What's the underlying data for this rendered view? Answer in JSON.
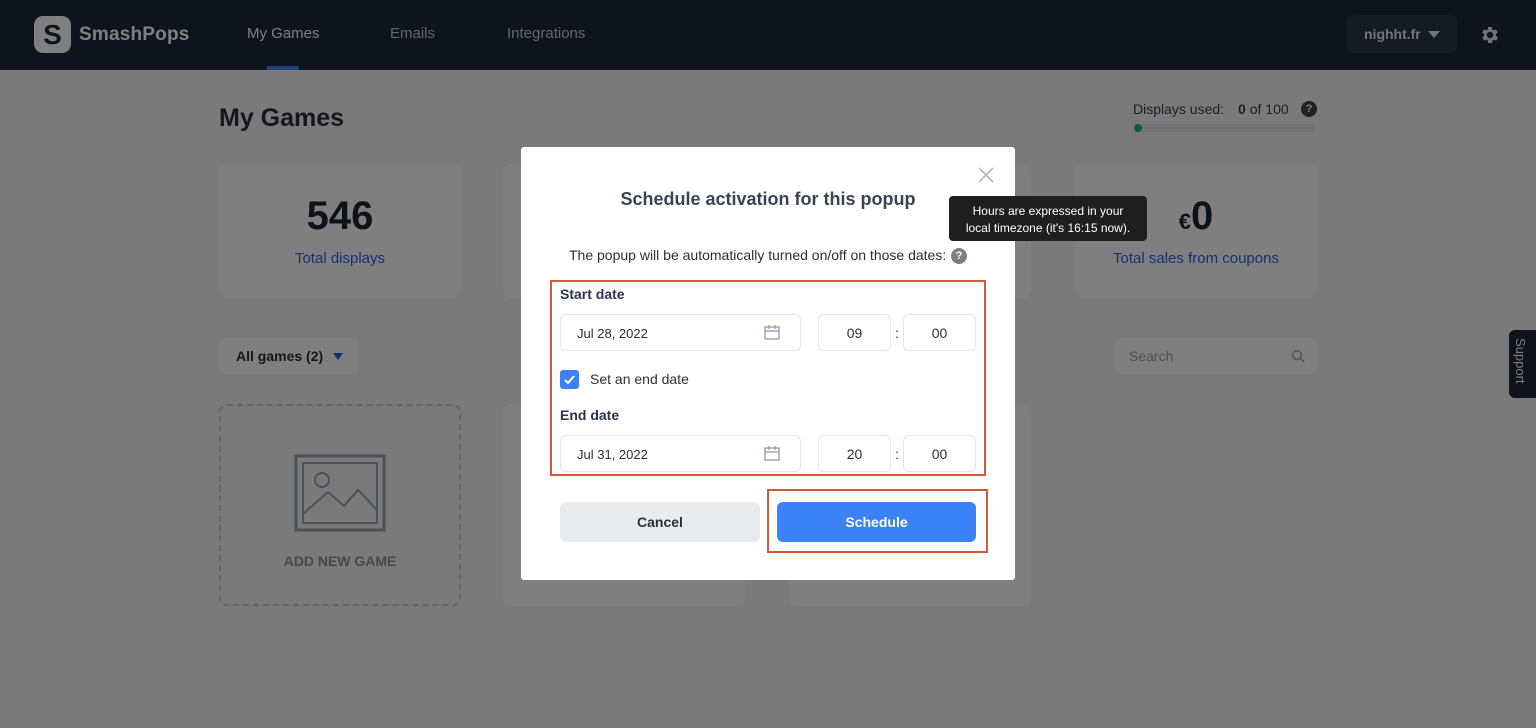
{
  "brand": {
    "logo_letter": "S",
    "name": "SmashPops"
  },
  "nav": {
    "items": [
      "My Games",
      "Emails",
      "Integrations"
    ],
    "active": "My Games"
  },
  "account": {
    "label": "nighht.fr"
  },
  "page": {
    "title": "My Games"
  },
  "usage": {
    "label": "Displays used:",
    "used": "0",
    "of": "of 100",
    "fraction": 0.0
  },
  "stats": [
    {
      "value": "546",
      "label": "Total displays"
    },
    {
      "value": "0",
      "currency": "€",
      "label": "Total sales from coupons"
    }
  ],
  "filter": {
    "label": "All games (2)"
  },
  "search": {
    "placeholder": "Search"
  },
  "add_game": {
    "label": "ADD NEW GAME"
  },
  "support": {
    "label": "Support"
  },
  "modal": {
    "title": "Schedule activation for this popup",
    "description": "The popup will be automatically turned on/off on those dates:",
    "start_label": "Start date",
    "start_date": "Jul 28, 2022",
    "start_hour": "09",
    "start_minute": "00",
    "end_checkbox_label": "Set an end date",
    "end_checked": true,
    "end_label": "End date",
    "end_date": "Jul 31, 2022",
    "end_hour": "20",
    "end_minute": "00",
    "time_separator": ":",
    "cancel": "Cancel",
    "schedule": "Schedule"
  },
  "tooltip": {
    "line1": "Hours are expressed in your",
    "line2": "local timezone (it's 16:15 now)."
  },
  "colors": {
    "accent": "#3b82f6",
    "nav_bg": "#1e2737",
    "highlight": "#d4583a"
  },
  "help_glyph": "?"
}
